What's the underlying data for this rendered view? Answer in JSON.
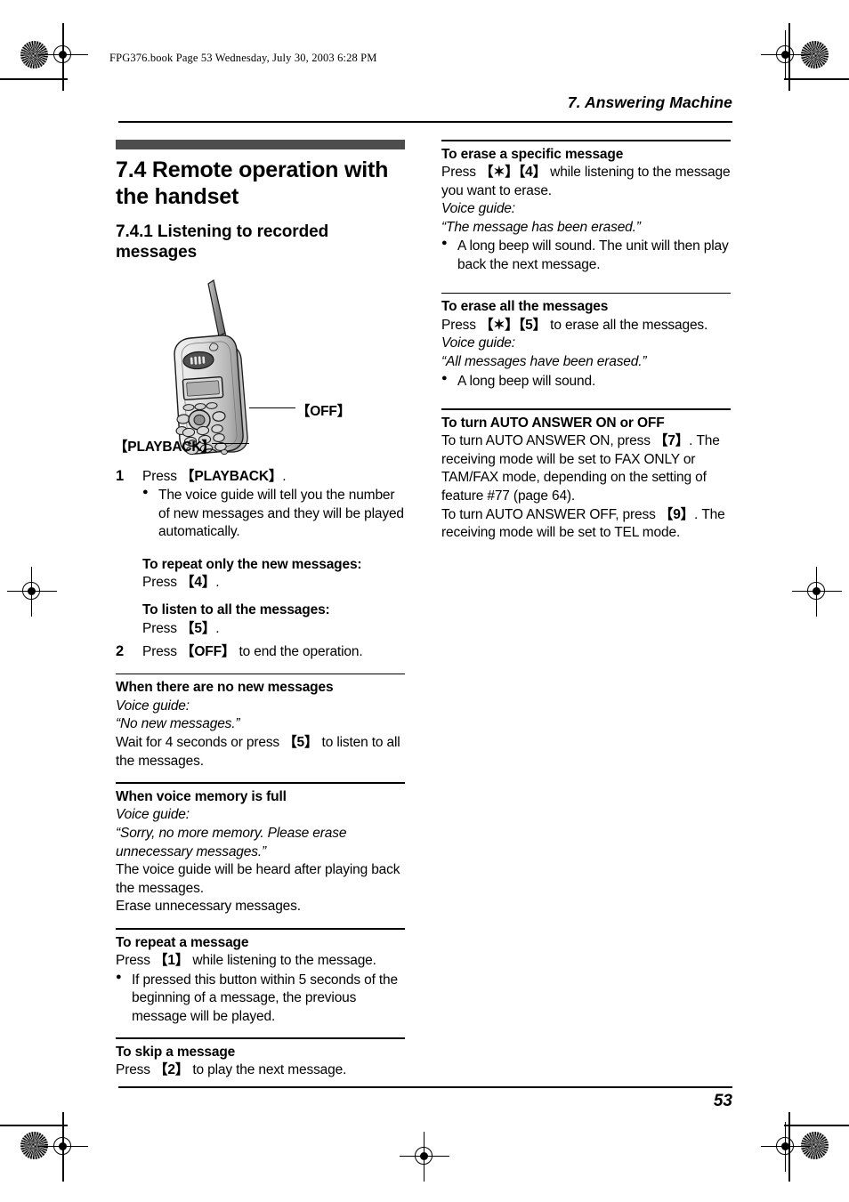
{
  "print_marks": {
    "file_stamp": "FPG376.book  Page 53  Wednesday, July 30, 2003  6:28 PM"
  },
  "running_head": {
    "chapter": "7. Answering Machine"
  },
  "running_foot": {
    "page_number": "53"
  },
  "left_column": {
    "section_title": "7.4 Remote operation with the handset",
    "subsection_title": "7.4.1 Listening to recorded messages",
    "figure": {
      "device": "cordless-handset",
      "callout_off": "【OFF】",
      "callout_playback": "【PLAYBACK】"
    },
    "step1": {
      "number": "1",
      "text_before": "Press ",
      "key": "【PLAYBACK】",
      "text_after": ".",
      "bullet": "The voice guide will tell you the number of new messages and they will be played automatically."
    },
    "repeat_new": {
      "heading": "To repeat only the new messages:",
      "press_before": "Press ",
      "key": "【4】",
      "press_after": "."
    },
    "listen_all": {
      "heading": "To listen to all the messages:",
      "press_before": "Press ",
      "key": "【5】",
      "press_after": "."
    },
    "step2": {
      "number": "2",
      "text_before": "Press ",
      "key": "【OFF】",
      "text_after": " to end the operation."
    },
    "no_new_messages": {
      "heading": "When there are no new messages",
      "voice_guide_label": "Voice guide:",
      "voice_guide_text": "“No new messages.”",
      "body_before": "Wait for 4 seconds or press ",
      "key": "【5】",
      "body_after": " to listen to all the messages."
    },
    "memory_full": {
      "heading": "When voice memory is full",
      "voice_guide_label": "Voice guide:",
      "voice_guide_text": "“Sorry, no more memory. Please erase unnecessary messages.”",
      "body1": "The voice guide will be heard after playing back the messages.",
      "body2": "Erase unnecessary messages."
    },
    "repeat_message": {
      "heading": "To repeat a message",
      "body_before": "Press ",
      "key": "【1】",
      "body_after": " while listening to the message.",
      "bullet": "If pressed this button within 5 seconds of the beginning of a message, the previous message will be played."
    },
    "skip_message": {
      "heading": "To skip a message",
      "body_before": "Press ",
      "key": "【2】",
      "body_after": " to play the next message."
    }
  },
  "right_column": {
    "erase_specific": {
      "heading": "To erase a specific message",
      "body_before": "Press ",
      "key1": "【✶】",
      "key2": "【4】",
      "body_after": " while listening to the message you want to erase.",
      "voice_guide_label": "Voice guide:",
      "voice_guide_text": "“The message has been erased.”",
      "bullet": "A long beep will sound. The unit will then play back the next message."
    },
    "erase_all": {
      "heading": "To erase all the messages",
      "body_before": "Press ",
      "key1": "【✶】",
      "key2": "【5】",
      "body_after": " to erase all the messages.",
      "voice_guide_label": "Voice guide:",
      "voice_guide_text": "“All messages have been erased.”",
      "bullet": "A long beep will sound."
    },
    "auto_answer": {
      "heading": "To turn AUTO ANSWER ON or OFF",
      "on_before": "To turn AUTO ANSWER ON, press ",
      "on_key": "【7】",
      "on_after": ". The receiving mode will be set to FAX ONLY or TAM/FAX mode, depending on the setting of feature #77 (page 64).",
      "off_before": "To turn AUTO ANSWER OFF, press ",
      "off_key": "【9】",
      "off_after": ". The receiving mode will be set to TEL mode."
    }
  }
}
